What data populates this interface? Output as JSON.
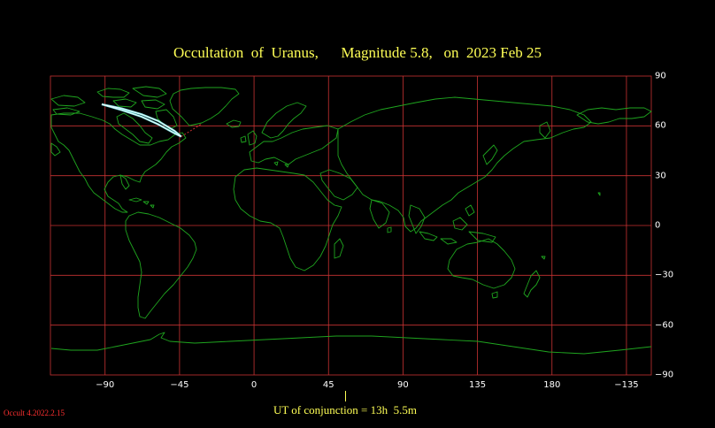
{
  "title": {
    "object_text": "Occultation  of  Uranus,",
    "magnitude_text": "Magnitude 5.8,",
    "date_text": "on  2023 Feb 25"
  },
  "axes": {
    "x_ticks": [
      {
        "lon": -90,
        "label": "−90"
      },
      {
        "lon": -45,
        "label": "−45"
      },
      {
        "lon": 0,
        "label": "0"
      },
      {
        "lon": 45,
        "label": "45"
      },
      {
        "lon": 90,
        "label": "90"
      },
      {
        "lon": 135,
        "label": "135"
      },
      {
        "lon": 180,
        "label": "180"
      },
      {
        "lon": 225,
        "label": "−135"
      }
    ],
    "y_ticks": [
      {
        "lat": 90,
        "label": "90"
      },
      {
        "lat": 60,
        "label": "60"
      },
      {
        "lat": 30,
        "label": "30"
      },
      {
        "lat": 0,
        "label": "0"
      },
      {
        "lat": -30,
        "label": "−30"
      },
      {
        "lat": -60,
        "label": "−60"
      },
      {
        "lat": -90,
        "label": "−90"
      }
    ],
    "lon_range": [
      -123,
      240
    ],
    "lat_range": [
      -90,
      90
    ]
  },
  "conjunction": {
    "label": "UT of conjunction = 13h  5.5m",
    "lon": 55
  },
  "version": "Occult 4.2022.2.15",
  "colors": {
    "background": "#000000",
    "grid": "#c83232",
    "coast": "#1fa51f",
    "path": "#7fe8e8",
    "path_edge": "#ffffff",
    "title": "#ffff55",
    "ticks": "#ffffff",
    "version": "#ff3030"
  },
  "occultation_path": {
    "north_limit": [
      [
        -92,
        73
      ],
      [
        -80,
        70.5
      ],
      [
        -68,
        67
      ],
      [
        -58,
        63
      ],
      [
        -48,
        57
      ],
      [
        -44,
        53.5
      ]
    ],
    "south_limit": [
      [
        -92,
        73
      ],
      [
        -80,
        69.5
      ],
      [
        -68,
        65.5
      ],
      [
        -58,
        61
      ],
      [
        -48,
        55.5
      ],
      [
        -44,
        53.5
      ]
    ],
    "extension": [
      [
        -44,
        53.5
      ],
      [
        -40,
        56
      ],
      [
        -36,
        58.5
      ],
      [
        -32,
        61
      ]
    ]
  }
}
